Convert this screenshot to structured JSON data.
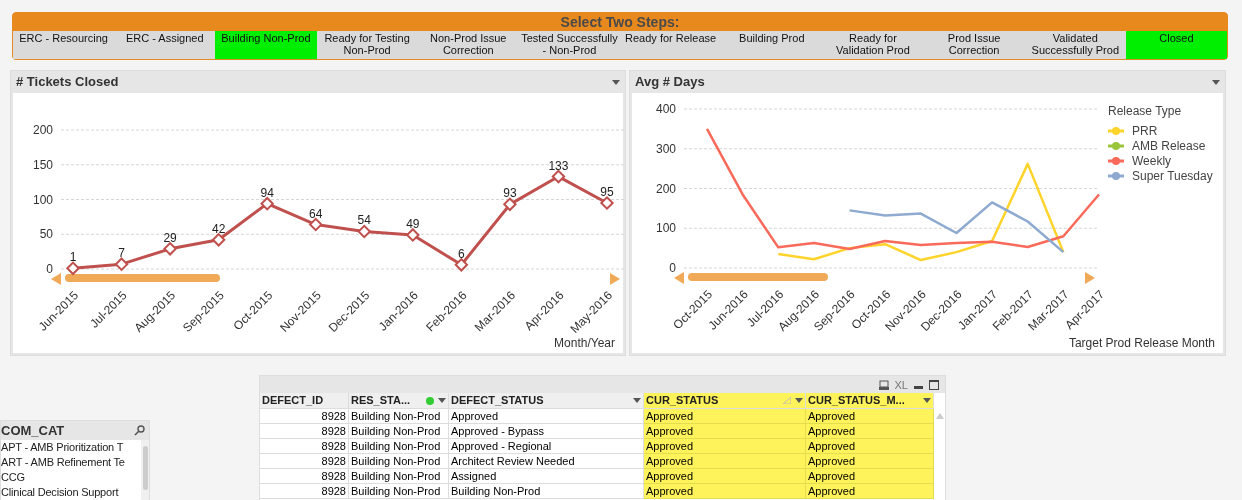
{
  "step_selector": {
    "title": "Select Two Steps:",
    "steps": [
      {
        "label": "ERC - Resourcing",
        "selected": false
      },
      {
        "label": "ERC - Assigned",
        "selected": false
      },
      {
        "label": "Building Non-Prod",
        "selected": true
      },
      {
        "label": "Ready for Testing Non-Prod",
        "selected": false
      },
      {
        "label": "Non-Prod Issue Correction",
        "selected": false
      },
      {
        "label": "Tested Successfully - Non-Prod",
        "selected": false
      },
      {
        "label": "Ready for Release",
        "selected": false
      },
      {
        "label": "Building Prod",
        "selected": false
      },
      {
        "label": "Ready for Validation Prod",
        "selected": false
      },
      {
        "label": "Prod Issue Correction",
        "selected": false
      },
      {
        "label": "Validated Successfully Prod",
        "selected": false
      },
      {
        "label": "Closed",
        "selected": true
      }
    ]
  },
  "charts": [
    {
      "title": "# Tickets Closed",
      "chart_data": {
        "type": "line",
        "xlabel": "Month/Year",
        "categories": [
          "Jun-2015",
          "Jul-2015",
          "Aug-2015",
          "Sep-2015",
          "Oct-2015",
          "Nov-2015",
          "Dec-2015",
          "Jan-2016",
          "Feb-2016",
          "Mar-2016",
          "Apr-2016",
          "May-2016"
        ],
        "series": [
          {
            "color": "#c0504d",
            "marker": "diamond",
            "values": [
              1,
              7,
              29,
              42,
              94,
              64,
              54,
              49,
              6,
              93,
              133,
              95
            ]
          }
        ],
        "ylim": [
          0,
          200
        ],
        "yticks": [
          0,
          50,
          100,
          150,
          200
        ],
        "grid": true,
        "data_labels": true
      }
    },
    {
      "title": "Avg # Days",
      "legend_title": "Release Type",
      "chart_data": {
        "type": "line",
        "xlabel": "Target Prod Release Month",
        "categories": [
          "Oct-2015",
          "Jun-2016",
          "Jul-2016",
          "Aug-2016",
          "Sep-2016",
          "Oct-2016",
          "Nov-2016",
          "Dec-2016",
          "Jan-2017",
          "Feb-2017",
          "Mar-2017",
          "Apr-2017"
        ],
        "series": [
          {
            "name": "PRR",
            "color": "#ffd42a",
            "values": [
              null,
              null,
              35,
              22,
              50,
              60,
              20,
              40,
              68,
              262,
              40,
              null
            ]
          },
          {
            "name": "AMB Release",
            "color": "#9bc53d",
            "values": [
              null,
              null,
              null,
              null,
              null,
              null,
              null,
              null,
              null,
              null,
              null,
              null
            ]
          },
          {
            "name": "Weekly",
            "color": "#f96a5a",
            "values": [
              350,
              185,
              52,
              63,
              48,
              68,
              58,
              63,
              66,
              53,
              80,
              185
            ]
          },
          {
            "name": "Super Tuesday",
            "color": "#8eaad0",
            "values": [
              null,
              null,
              null,
              null,
              145,
              132,
              137,
              88,
              165,
              117,
              40,
              null
            ]
          }
        ],
        "ylim": [
          0,
          400
        ],
        "yticks": [
          0,
          100,
          200,
          300,
          400
        ],
        "grid": true,
        "legend": true
      }
    }
  ],
  "list_box": {
    "title": "COM_CAT",
    "items": [
      "APT - AMB Prioritization T",
      "ART - AMB Refinement Te",
      "CCG",
      "Clinical Decision Support"
    ]
  },
  "table": {
    "columns": [
      {
        "label": "DEFECT_ID",
        "dropdown": false,
        "filtered": false,
        "sorted": false,
        "highlighted": false
      },
      {
        "label": "RES_STA...",
        "dropdown": true,
        "filtered": true,
        "sorted": false,
        "highlighted": false
      },
      {
        "label": "DEFECT_STATUS",
        "dropdown": true,
        "filtered": false,
        "sorted": false,
        "highlighted": false
      },
      {
        "label": "CUR_STATUS",
        "dropdown": true,
        "filtered": false,
        "sorted": true,
        "highlighted": true
      },
      {
        "label": "CUR_STATUS_M...",
        "dropdown": true,
        "filtered": false,
        "sorted": false,
        "highlighted": true
      }
    ],
    "toolbar": [
      "XL"
    ],
    "rows": [
      [
        "8928",
        "Building Non-Prod",
        "Approved",
        "Approved",
        "Approved"
      ],
      [
        "8928",
        "Building Non-Prod",
        "Approved - Bypass",
        "Approved",
        "Approved"
      ],
      [
        "8928",
        "Building Non-Prod",
        "Approved - Regional",
        "Approved",
        "Approved"
      ],
      [
        "8928",
        "Building Non-Prod",
        "Architect Review Needed",
        "Approved",
        "Approved"
      ],
      [
        "8928",
        "Building Non-Prod",
        "Assigned",
        "Approved",
        "Approved"
      ],
      [
        "8928",
        "Building Non-Prod",
        "Building Non-Prod",
        "Approved",
        "Approved"
      ]
    ]
  }
}
